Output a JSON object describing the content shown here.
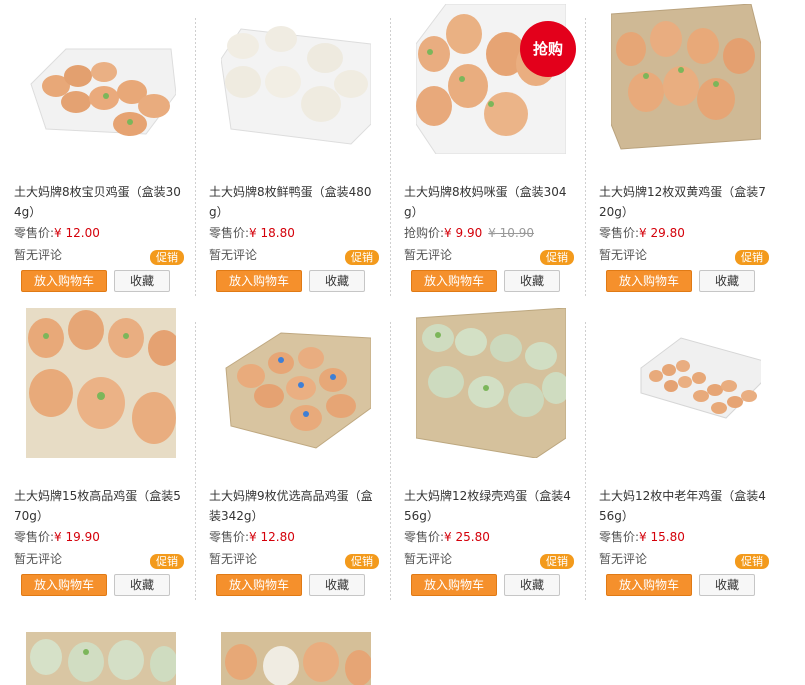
{
  "products": [
    {
      "title": "土大妈牌8枚宝贝鸡蛋（盒装304g）",
      "price_label": "零售价:",
      "price": "¥ 12.00",
      "old_price": "",
      "review": "暂无评论",
      "promo": "促销",
      "cart": "放入购物车",
      "fav": "收藏"
    },
    {
      "title": "土大妈牌8枚鲜鸭蛋（盒装480g）",
      "price_label": "零售价:",
      "price": "¥ 18.80",
      "old_price": "",
      "review": "暂无评论",
      "promo": "促销",
      "cart": "放入购物车",
      "fav": "收藏"
    },
    {
      "title": "土大妈牌8枚妈咪蛋（盒装304g）",
      "price_label": "抢购价:",
      "price": "¥ 9.90",
      "old_price": "¥ 10.90",
      "review": "暂无评论",
      "promo": "促销",
      "cart": "放入购物车",
      "fav": "收藏",
      "badge": "抢购"
    },
    {
      "title": "土大妈牌12枚双黄鸡蛋（盒装720g）",
      "price_label": "零售价:",
      "price": "¥ 29.80",
      "old_price": "",
      "review": "暂无评论",
      "promo": "促销",
      "cart": "放入购物车",
      "fav": "收藏"
    },
    {
      "title": "土大妈牌15枚高品鸡蛋（盒装570g）",
      "price_label": "零售价:",
      "price": "¥ 19.90",
      "old_price": "",
      "review": "暂无评论",
      "promo": "促销",
      "cart": "放入购物车",
      "fav": "收藏"
    },
    {
      "title": "土大妈牌9枚优选高品鸡蛋（盒装342g）",
      "price_label": "零售价:",
      "price": "¥ 12.80",
      "old_price": "",
      "review": "暂无评论",
      "promo": "促销",
      "cart": "放入购物车",
      "fav": "收藏"
    },
    {
      "title": "土大妈牌12枚绿壳鸡蛋（盒装456g）",
      "price_label": "零售价:",
      "price": "¥ 25.80",
      "old_price": "",
      "review": "暂无评论",
      "promo": "促销",
      "cart": "放入购物车",
      "fav": "收藏"
    },
    {
      "title": "土大妈12枚中老年鸡蛋（盒装456g）",
      "price_label": "零售价:",
      "price": "¥ 15.80",
      "old_price": "",
      "review": "暂无评论",
      "promo": "促销",
      "cart": "放入购物车",
      "fav": "收藏"
    }
  ],
  "colors": {
    "accent": "#f5902c",
    "price": "#d4000a",
    "flash": "#e3001b"
  }
}
